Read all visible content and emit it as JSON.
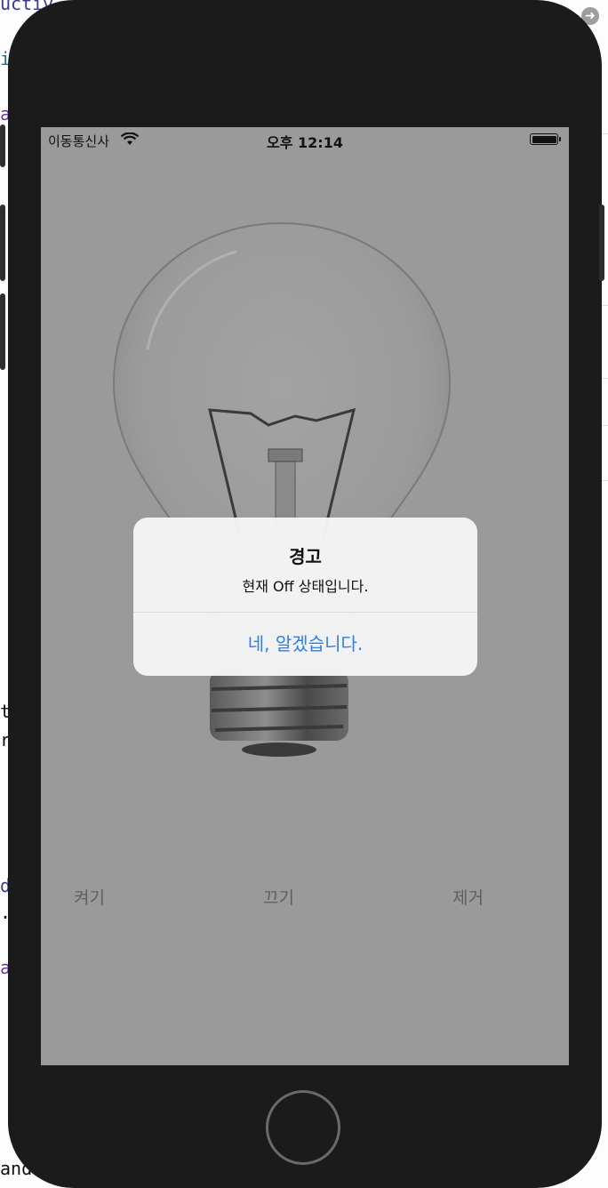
{
  "editor_fragments": {
    "f1": "uctiv",
    "f2": "i",
    "f3": "a",
    "f4": "t",
    "f5": "r",
    "f6": "d",
    "f7": ".",
    "f8": "a",
    "f9": "and"
  },
  "status_bar": {
    "carrier": "이동통신사",
    "time": "오후 12:14",
    "wifi_icon": "wifi-icon",
    "battery_level": 1.0
  },
  "controls": {
    "on_label": "켜기",
    "off_label": "끄기",
    "remove_label": "제거"
  },
  "alert": {
    "title": "경고",
    "message": "현재 Off 상태입니다.",
    "action_label": "네, 알겠습니다.",
    "action_color": "#2f7fe6"
  },
  "colors": {
    "device": "#1b1b1b",
    "dim_overlay": "#9a9a9a"
  }
}
